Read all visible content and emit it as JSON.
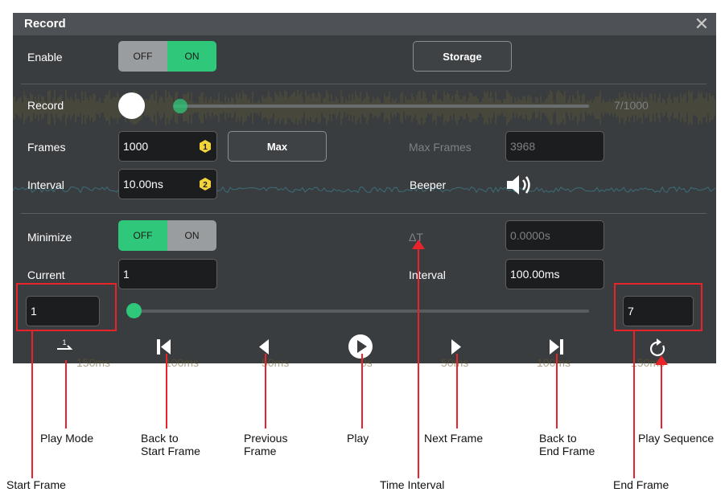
{
  "dialog": {
    "title": "Record"
  },
  "enable": {
    "label": "Enable",
    "off": "OFF",
    "on": "ON"
  },
  "storage_button": "Storage",
  "record": {
    "label": "Record",
    "counter": "7/1000"
  },
  "frames": {
    "label": "Frames",
    "value": "1000",
    "badge": "1",
    "max_button": "Max"
  },
  "max_frames": {
    "label": "Max Frames",
    "value": "3968"
  },
  "interval": {
    "label": "Interval",
    "value": "10.00ns",
    "badge": "2"
  },
  "beeper": {
    "label": "Beeper",
    "icon": "speaker-icon",
    "state": "on"
  },
  "minimize": {
    "label": "Minimize",
    "off": "OFF",
    "on": "ON"
  },
  "delta_t": {
    "label": "ΔT",
    "value": "0.0000s"
  },
  "current": {
    "label": "Current",
    "value": "1"
  },
  "play_interval": {
    "label": "Interval",
    "value": "100.00ms"
  },
  "playback": {
    "start_frame": "1",
    "end_frame": "7",
    "position": 0
  },
  "axis_labels": [
    "150ms",
    "100ms",
    "50ms",
    "0s",
    "50ms",
    "100ms",
    "150ms"
  ],
  "annotations": {
    "play_mode": "Play Mode",
    "back_start_1": "Back to",
    "back_start_2": "Start Frame",
    "previous_1": "Previous",
    "previous_2": "Frame",
    "play": "Play",
    "next": "Next Frame",
    "back_end_1": "Back to",
    "back_end_2": "End Frame",
    "play_sequence": "Play Sequence",
    "start_frame": "Start Frame",
    "time_interval": "Time Interval",
    "end_frame": "End Frame"
  },
  "colors": {
    "accent": "#2fc77a",
    "badge": "#f2d33a",
    "annotation": "#e8232a",
    "panel": "#3a3d40"
  }
}
